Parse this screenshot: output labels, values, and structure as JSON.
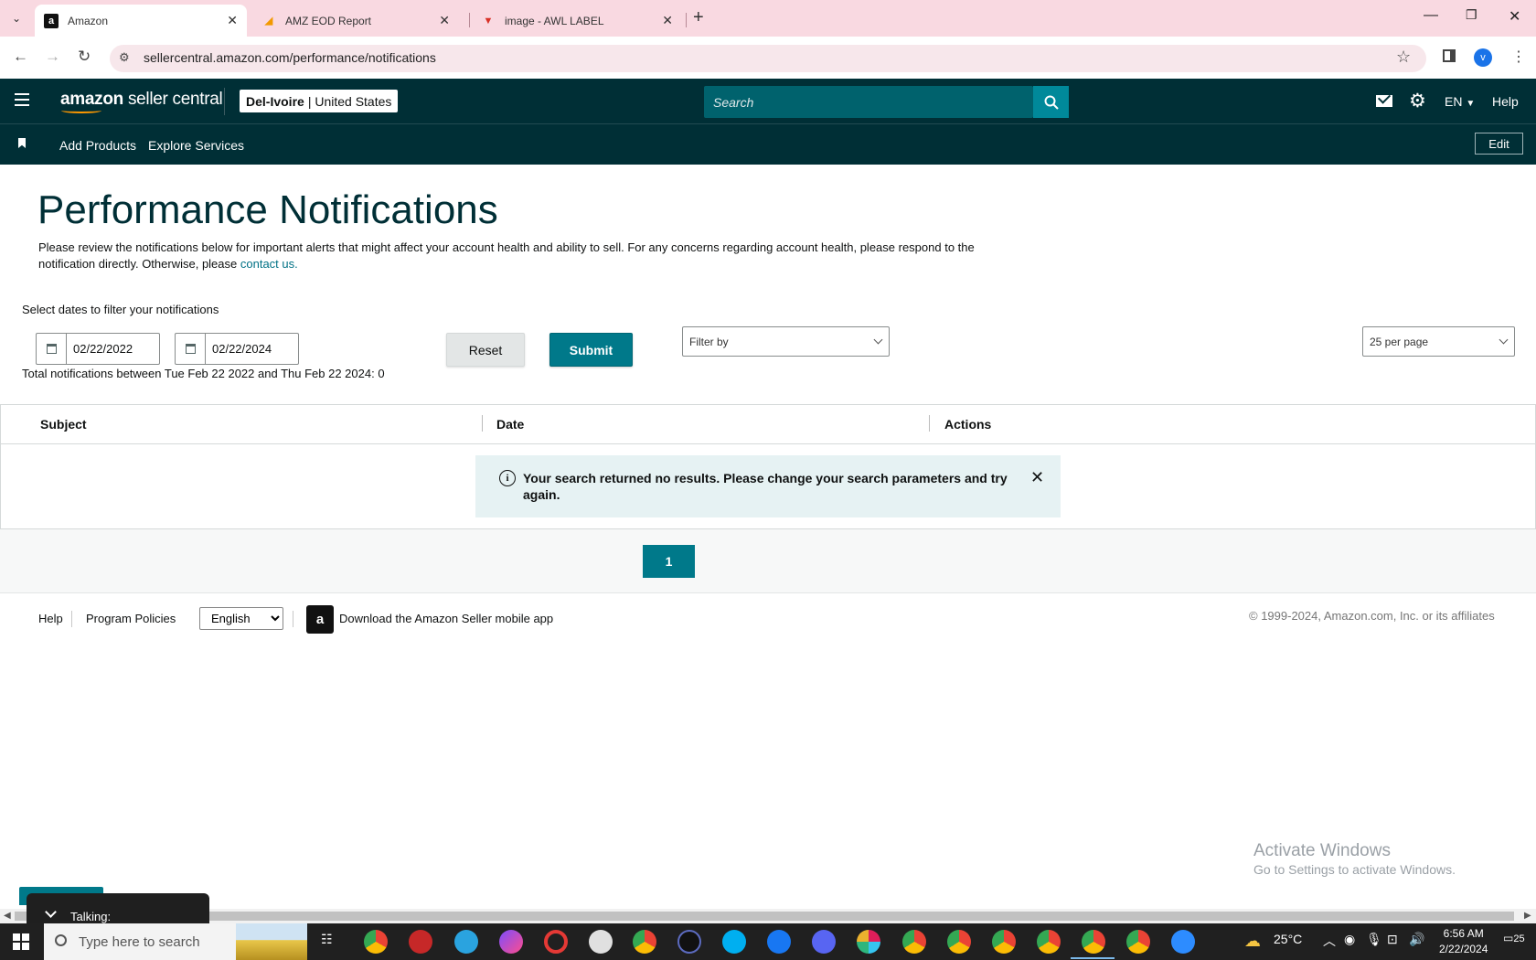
{
  "browser": {
    "tabs": [
      {
        "title": "Amazon",
        "favicon": "a"
      },
      {
        "title": "AMZ EOD Report",
        "favicon": "chart-icon"
      },
      {
        "title": "image - AWL LABEL",
        "favicon": "v-icon"
      }
    ],
    "url": "sellercentral.amazon.com/performance/notifications",
    "profile_initial": "v"
  },
  "header": {
    "logo_brand": "amazon",
    "logo_product": "seller central",
    "store_name": "Del-Ivoire",
    "store_region": "United States",
    "search_placeholder": "Search",
    "language": "EN",
    "help": "Help"
  },
  "subnav": {
    "links": [
      "Add Products",
      "Explore Services"
    ],
    "edit": "Edit"
  },
  "page": {
    "title": "Performance Notifications",
    "intro": "Please review the notifications below for important alerts that might affect your account health and ability to sell. For any concerns regarding account health, please respond to the notification directly. Otherwise, please",
    "intro_link": "contact us."
  },
  "filters": {
    "label": "Select dates to filter your notifications",
    "start_date": "02/22/2022",
    "end_date": "02/22/2024",
    "reset": "Reset",
    "submit": "Submit",
    "filter_by": "Filter by",
    "per_page": "25 per page",
    "total": "Total notifications between Tue Feb 22 2022 and Thu Feb 22 2024: 0"
  },
  "table": {
    "columns": [
      "Subject",
      "Date",
      "Actions"
    ],
    "empty_message": "Your search returned no results. Please change your search parameters and try again."
  },
  "pagination": {
    "current_page": "1"
  },
  "footer": {
    "help": "Help",
    "policies": "Program Policies",
    "language": "English",
    "app": "Download the Amazon Seller mobile app",
    "copyright": "© 1999-2024, Amazon.com, Inc. or its affiliates"
  },
  "watermark": {
    "line1": "Activate Windows",
    "line2": "Go to Settings to activate Windows."
  },
  "talking": {
    "label": "Talking:"
  },
  "taskbar": {
    "search_placeholder": "Type here to search",
    "weather": "25°C",
    "time": "6:56 AM",
    "date": "2/22/2024",
    "notifications": "25"
  },
  "colors": {
    "header_bg": "#002f36",
    "accent": "#00798a",
    "tab_strip": "#f9d9e1"
  }
}
